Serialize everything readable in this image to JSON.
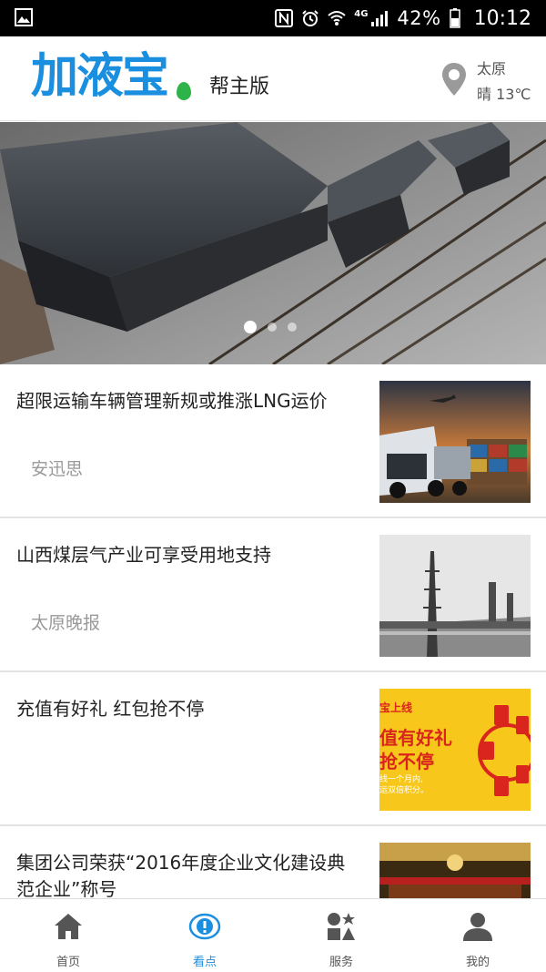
{
  "status_bar": {
    "signal_label": "4G",
    "battery_percent": "42%",
    "time": "10:12"
  },
  "header": {
    "logo_text": "加液宝",
    "edition": "帮主版",
    "location_city": "太原",
    "weather": "晴 13℃"
  },
  "banner": {
    "slide_count": 3,
    "active_slide": 1
  },
  "news": [
    {
      "title": "超限运输车辆管理新规或推涨LNG运价",
      "source": "安迅思",
      "thumb": "truck-cargo"
    },
    {
      "title": "山西煤层气产业可享受用地支持",
      "source": "太原晚报",
      "thumb": "industrial-tower"
    },
    {
      "title": "充值有好礼 红包抢不停",
      "source": "",
      "thumb": "red-packet-promo",
      "thumb_text": {
        "line1": "宝上线",
        "line2": "值有好礼",
        "line3": "抢不停",
        "line4": "线一个月内,",
        "line5": "运双倍积分。"
      }
    },
    {
      "title": "集团公司荣获“2016年度企业文化建设典范企业”称号",
      "source": "",
      "thumb": "award-hall"
    }
  ],
  "tabs": [
    {
      "label": "首页",
      "icon": "home-icon",
      "active": false
    },
    {
      "label": "看点",
      "icon": "highlights-icon",
      "active": true
    },
    {
      "label": "服务",
      "icon": "services-icon",
      "active": false
    },
    {
      "label": "我的",
      "icon": "profile-icon",
      "active": false
    }
  ],
  "colors": {
    "brand_blue": "#1a8fe0",
    "brand_green": "#2db34a",
    "promo_yellow": "#f7c81b",
    "promo_red": "#d9251d"
  }
}
